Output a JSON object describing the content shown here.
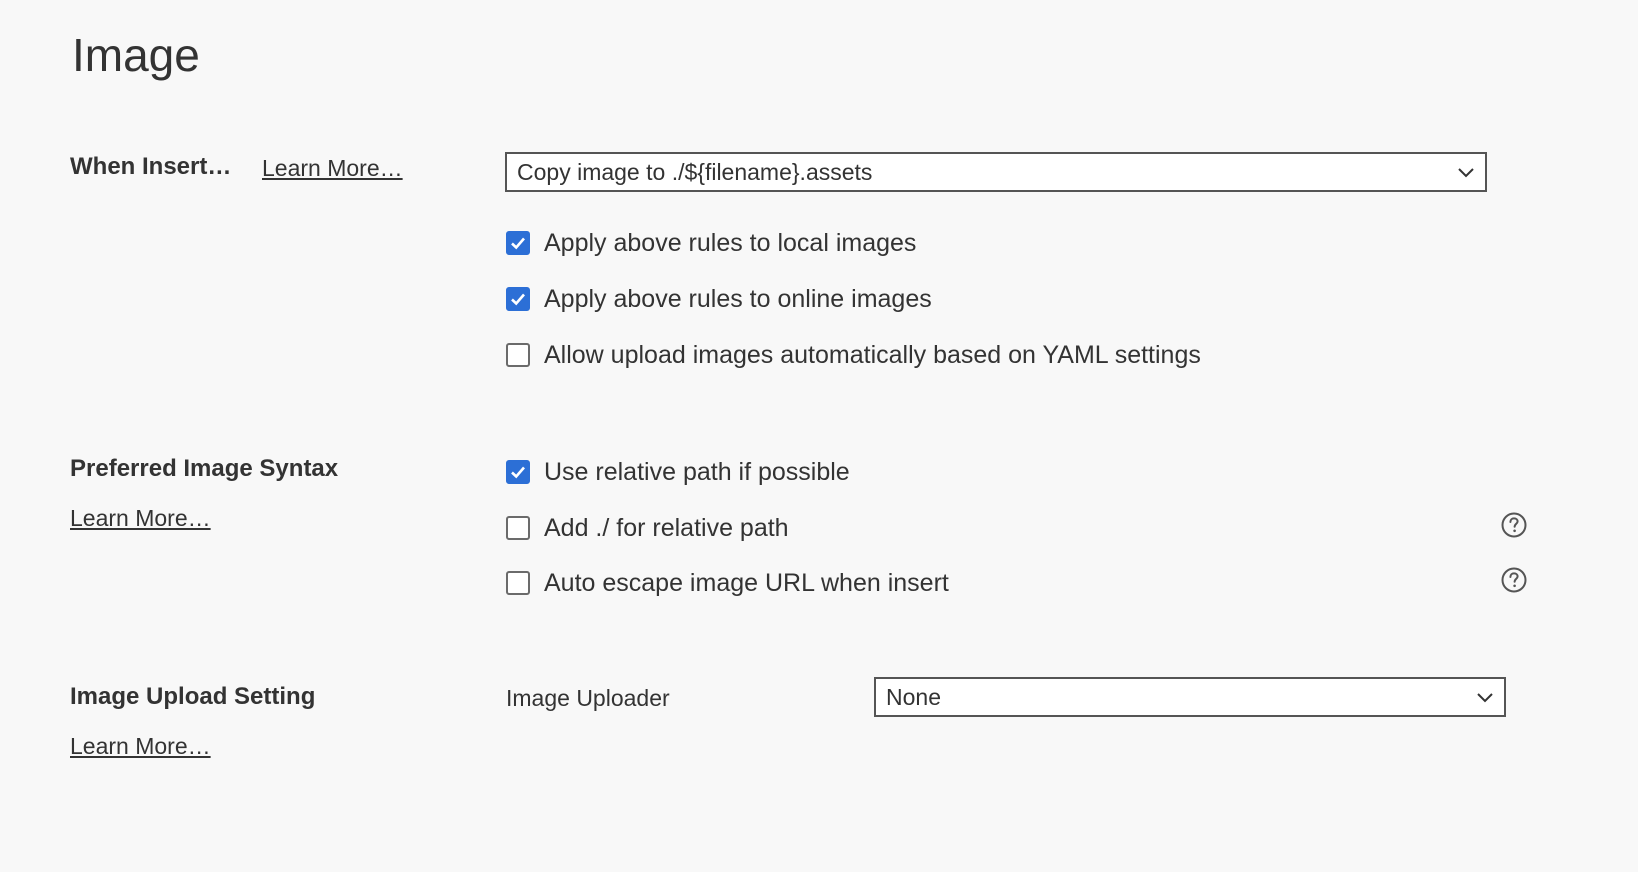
{
  "page": {
    "title": "Image"
  },
  "when_insert": {
    "label": "When Insert…",
    "learn_more": "Learn More…",
    "select_value": "Copy image to ./${filename}.assets",
    "options": [
      {
        "label": "Apply above rules to local images",
        "checked": true
      },
      {
        "label": "Apply above rules to online images",
        "checked": true
      },
      {
        "label": "Allow upload images automatically based on YAML settings",
        "checked": false
      }
    ]
  },
  "preferred_syntax": {
    "label": "Preferred Image Syntax",
    "learn_more": "Learn More…",
    "options": [
      {
        "label": "Use relative path if possible",
        "checked": true,
        "help": false
      },
      {
        "label": "Add ./ for relative path",
        "checked": false,
        "help": true
      },
      {
        "label": "Auto escape image URL when insert",
        "checked": false,
        "help": true
      }
    ]
  },
  "upload_setting": {
    "label": "Image Upload Setting",
    "learn_more": "Learn More…",
    "uploader_label": "Image Uploader",
    "uploader_value": "None"
  },
  "colors": {
    "background": "#f8f8f8",
    "text": "#333333",
    "checkbox_checked": "#2c6fd6",
    "border": "#555555"
  },
  "icons": {
    "select_arrow": "chevron-down-icon",
    "checked_mark": "checkmark-icon",
    "help": "question-circle-icon"
  }
}
